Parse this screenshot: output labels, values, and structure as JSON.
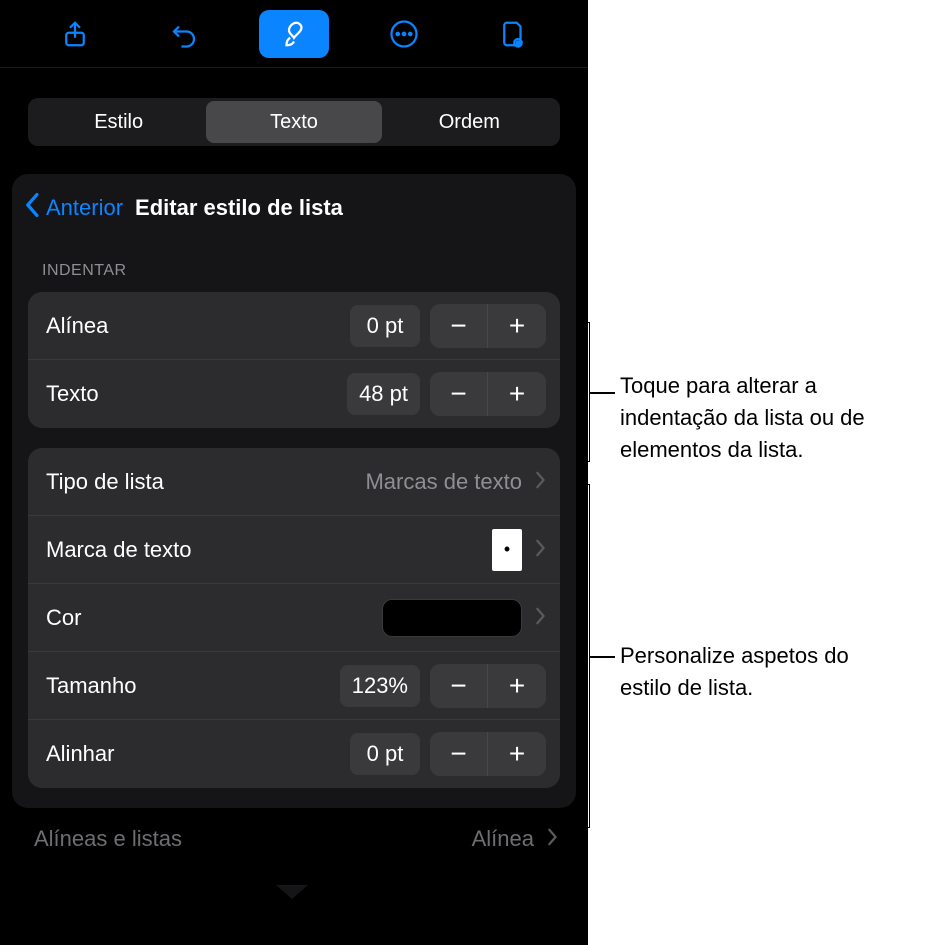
{
  "toolbar": {
    "icons": [
      "share",
      "undo",
      "format",
      "more",
      "collaborate"
    ]
  },
  "segmented": {
    "items": [
      "Estilo",
      "Texto",
      "Ordem"
    ],
    "selected": 1
  },
  "header": {
    "back": "Anterior",
    "title": "Editar estilo de lista"
  },
  "indent": {
    "section_label": "INDENTAR",
    "bullet_label": "Alínea",
    "bullet_value": "0 pt",
    "text_label": "Texto",
    "text_value": "48 pt",
    "minus": "−",
    "plus": "+"
  },
  "style": {
    "list_type_label": "Tipo de lista",
    "list_type_value": "Marcas de texto",
    "text_bullet_label": "Marca de texto",
    "text_bullet_glyph": "•",
    "color_label": "Cor",
    "size_label": "Tamanho",
    "size_value": "123%",
    "align_label": "Alinhar",
    "align_value": "0 pt",
    "minus": "−",
    "plus": "+"
  },
  "bottom": {
    "label": "Alíneas e listas",
    "value": "Alínea"
  },
  "callouts": {
    "c1": "Toque para alterar a indentação da lista ou de elementos da lista.",
    "c2": "Personalize aspetos do estilo de lista."
  }
}
